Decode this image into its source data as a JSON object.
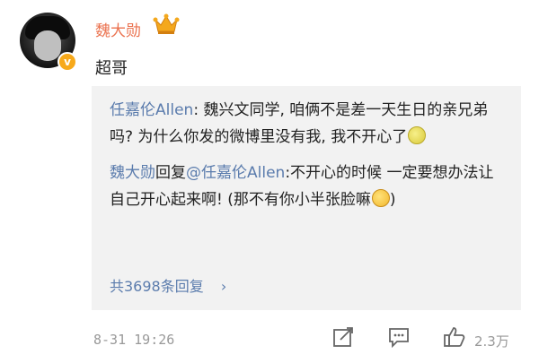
{
  "post": {
    "author": "魏大勋",
    "content": "超哥",
    "timestamp": "8-31 19:26",
    "likes": "2.3万",
    "verified_badge": "v"
  },
  "reply_box": {
    "comment1_author": "任嘉伦Allen",
    "comment1_sep": ":",
    "comment1_text": "魏兴文同学, 咱俩不是差一天生日的亲兄弟吗? 为什么你发的微博里没有我, 我不开心了",
    "comment2_author": "魏大勋",
    "comment2_verb": "回复",
    "comment2_mention": "@任嘉伦Allen",
    "comment2_text": ":不开心的时候 一定要想办法让自己开心起来啊! (那不有你小半张脸嘛",
    "comment2_end": ")",
    "more_replies": "共3698条回复",
    "more_chevron": "›"
  },
  "icons": {
    "crown": "crown-badge-icon",
    "share": "share-icon",
    "comment": "comment-icon",
    "like": "like-icon"
  },
  "colors": {
    "username": "#eb7350",
    "link": "#5b7cad",
    "reply_bg": "#f2f2f2",
    "meta": "#999999"
  }
}
